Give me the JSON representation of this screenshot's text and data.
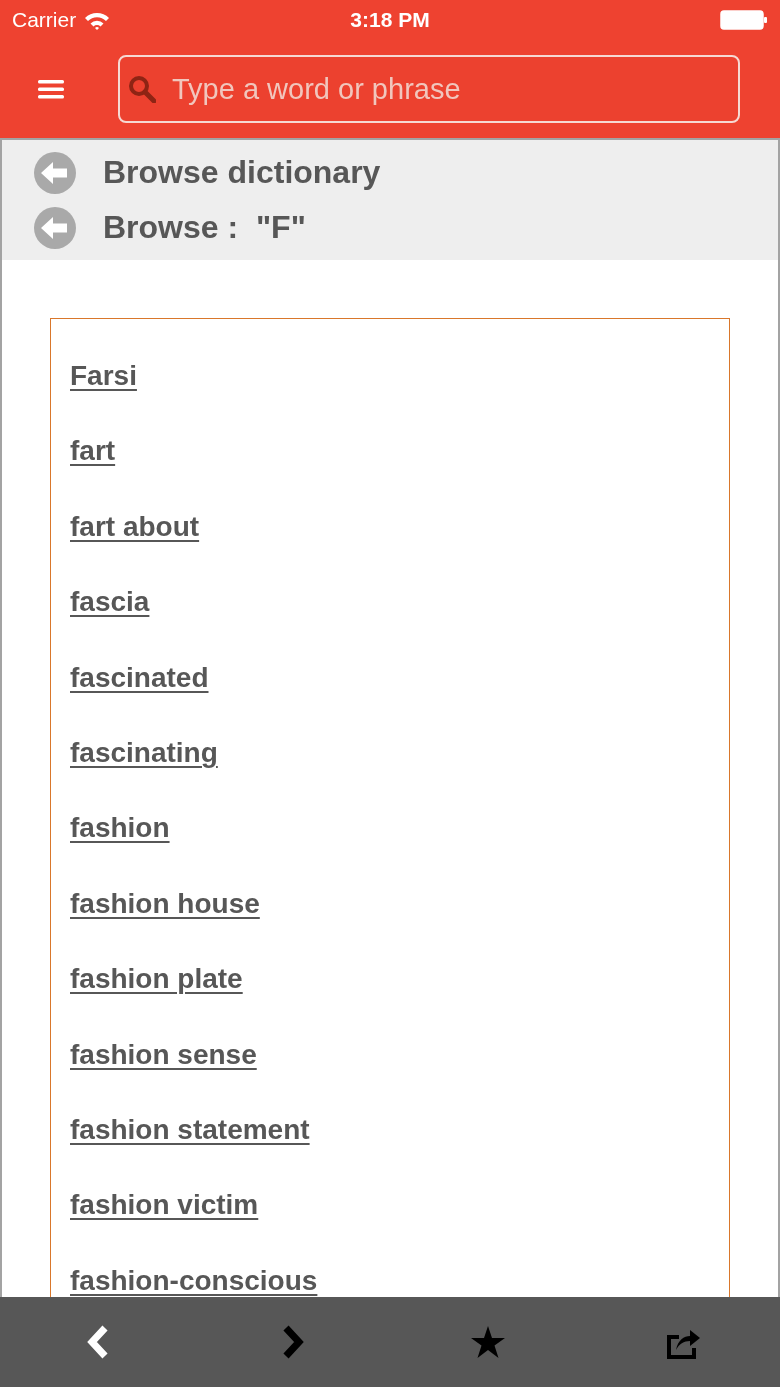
{
  "status_bar": {
    "carrier": "Carrier",
    "time": "3:18 PM"
  },
  "search": {
    "placeholder": "Type a word or phrase"
  },
  "breadcrumbs": [
    {
      "label": "Browse dictionary"
    },
    {
      "label": "Browse :  \"F\""
    }
  ],
  "words": [
    "Farsi",
    "fart",
    "fart about",
    "fascia",
    "fascinated",
    "fascinating",
    "fashion",
    "fashion house",
    "fashion plate",
    "fashion sense",
    "fashion statement",
    "fashion victim",
    "fashion-conscious"
  ]
}
